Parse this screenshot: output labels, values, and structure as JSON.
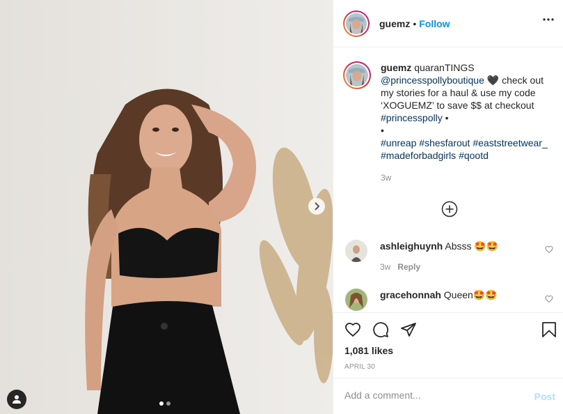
{
  "post": {
    "username": "guemz",
    "separator": "•",
    "follow_label": "Follow",
    "more_icon": "more-horizontal-icon",
    "carousel_dots": 2,
    "carousel_active": 0
  },
  "caption": {
    "username": "guemz",
    "text_start": " quaranTINGS ",
    "mention": "@princesspollyboutique",
    "heart": " 🖤 ",
    "text_mid": "check out my stories for a haul & use my code ‘XOGUEMZ’ to save $$ at checkout ",
    "hashtag1": "#princesspolly",
    "bullet1": " •",
    "bullet2": "•",
    "hashtag2": "#unreap",
    "hashtag3": "#shesfarout",
    "hashtag4": "#eaststreetwear_",
    "hashtag5": "#madeforbadgirls",
    "hashtag6": "#qootd",
    "time": "3w"
  },
  "comments": [
    {
      "username": "ashleighuynh",
      "text": " Absss 🤩🤩",
      "time": "3w",
      "reply_label": "Reply"
    },
    {
      "username": "gracehonnah",
      "text": " Queen🤩🤩"
    }
  ],
  "actions": {
    "likes": "1,081 likes",
    "date": "APRIL 30"
  },
  "add_comment": {
    "placeholder": "Add a comment...",
    "post_label": "Post"
  },
  "colors": {
    "accent": "#0095f6",
    "link": "#00376b",
    "muted": "#8e8e8e",
    "post_disabled": "#b2dffc"
  }
}
